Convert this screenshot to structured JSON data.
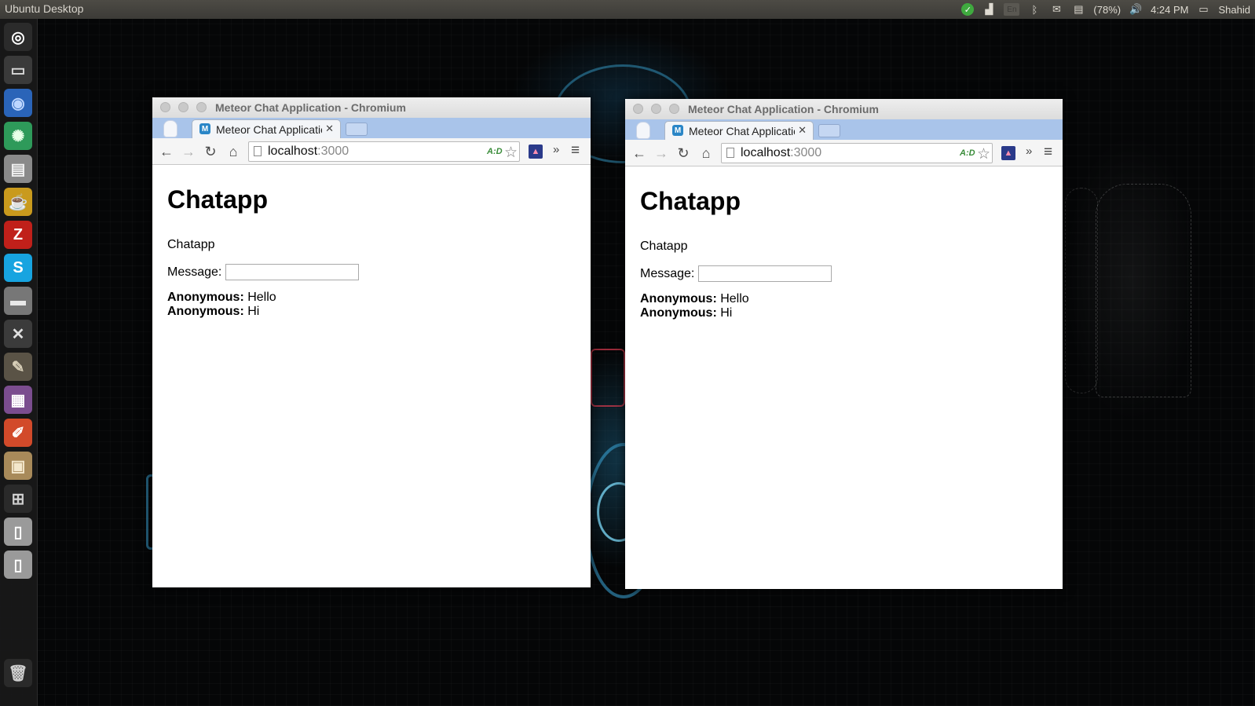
{
  "desktop": {
    "panel_title": "Ubuntu Desktop",
    "tray": {
      "battery": "(78%)",
      "input_lang": "En",
      "clock": "4:24 PM",
      "user": "Shahid"
    },
    "launcher": [
      {
        "name": "ubuntu-dash-icon",
        "glyph": "◎",
        "bg": "#2b2b2b",
        "color": "#ffffff"
      },
      {
        "name": "terminal-icon",
        "glyph": "▭",
        "bg": "#3a3a3a",
        "color": "#d8d8d8"
      },
      {
        "name": "chromium-icon",
        "glyph": "◉",
        "bg": "#2a64b8",
        "color": "#bcd6ff"
      },
      {
        "name": "atom-icon",
        "glyph": "✺",
        "bg": "#2e9a5a",
        "color": "#e8ffe8"
      },
      {
        "name": "files-icon",
        "glyph": "▤",
        "bg": "#8a8a8a",
        "color": "#f0f0f0"
      },
      {
        "name": "teapot-icon",
        "glyph": "☕",
        "bg": "#c99a1d",
        "color": "#fff6c8"
      },
      {
        "name": "filezilla-icon",
        "glyph": "Z",
        "bg": "#c0201a",
        "color": "#ffffff"
      },
      {
        "name": "skype-icon",
        "glyph": "S",
        "bg": "#17a4e0",
        "color": "#ffffff"
      },
      {
        "name": "drive-icon",
        "glyph": "▬",
        "bg": "#777777",
        "color": "#e8e8e8"
      },
      {
        "name": "tools-icon",
        "glyph": "✕",
        "bg": "#3b3b3b",
        "color": "#e0e0e0"
      },
      {
        "name": "gimp-icon",
        "glyph": "✎",
        "bg": "#5a5346",
        "color": "#d8cfb8"
      },
      {
        "name": "video-icon",
        "glyph": "▦",
        "bg": "#7b4d8f",
        "color": "#ffffff"
      },
      {
        "name": "editor-icon",
        "glyph": "✐",
        "bg": "#d24a2a",
        "color": "#ffffff"
      },
      {
        "name": "folder-icon",
        "glyph": "▣",
        "bg": "#a88a5a",
        "color": "#f3e7cc"
      },
      {
        "name": "workspace-switcher-icon",
        "glyph": "⊞",
        "bg": "#2a2a2a",
        "color": "#cfcfcf"
      },
      {
        "name": "phone-icon",
        "glyph": "▯",
        "bg": "#9a9a9a",
        "color": "#ffffff"
      },
      {
        "name": "phone-icon",
        "glyph": "▯",
        "bg": "#9a9a9a",
        "color": "#ffffff"
      },
      {
        "name": "trash-icon",
        "glyph": "🗑",
        "bg": "#2a2a2a",
        "color": "#cfcfcf"
      }
    ]
  },
  "windows": [
    {
      "title": "Meteor Chat Application - Chromium",
      "tab_label": "Meteor Chat Application",
      "tab_favicon": "M",
      "url_host": "localhost",
      "url_port": ":3000",
      "page": {
        "heading": "Chatapp",
        "subtitle": "Chatapp",
        "message_label": "Message:",
        "message_value": "",
        "messages": [
          {
            "author": "Anonymous:",
            "text": " Hello"
          },
          {
            "author": "Anonymous:",
            "text": " Hi"
          }
        ]
      }
    },
    {
      "title": "Meteor Chat Application - Chromium",
      "tab_label": "Meteor Chat Application",
      "tab_favicon": "M",
      "url_host": "localhost",
      "url_port": ":3000",
      "page": {
        "heading": "Chatapp",
        "subtitle": "Chatapp",
        "message_label": "Message:",
        "message_value": "",
        "messages": [
          {
            "author": "Anonymous:",
            "text": " Hello"
          },
          {
            "author": "Anonymous:",
            "text": " Hi"
          }
        ]
      }
    }
  ]
}
